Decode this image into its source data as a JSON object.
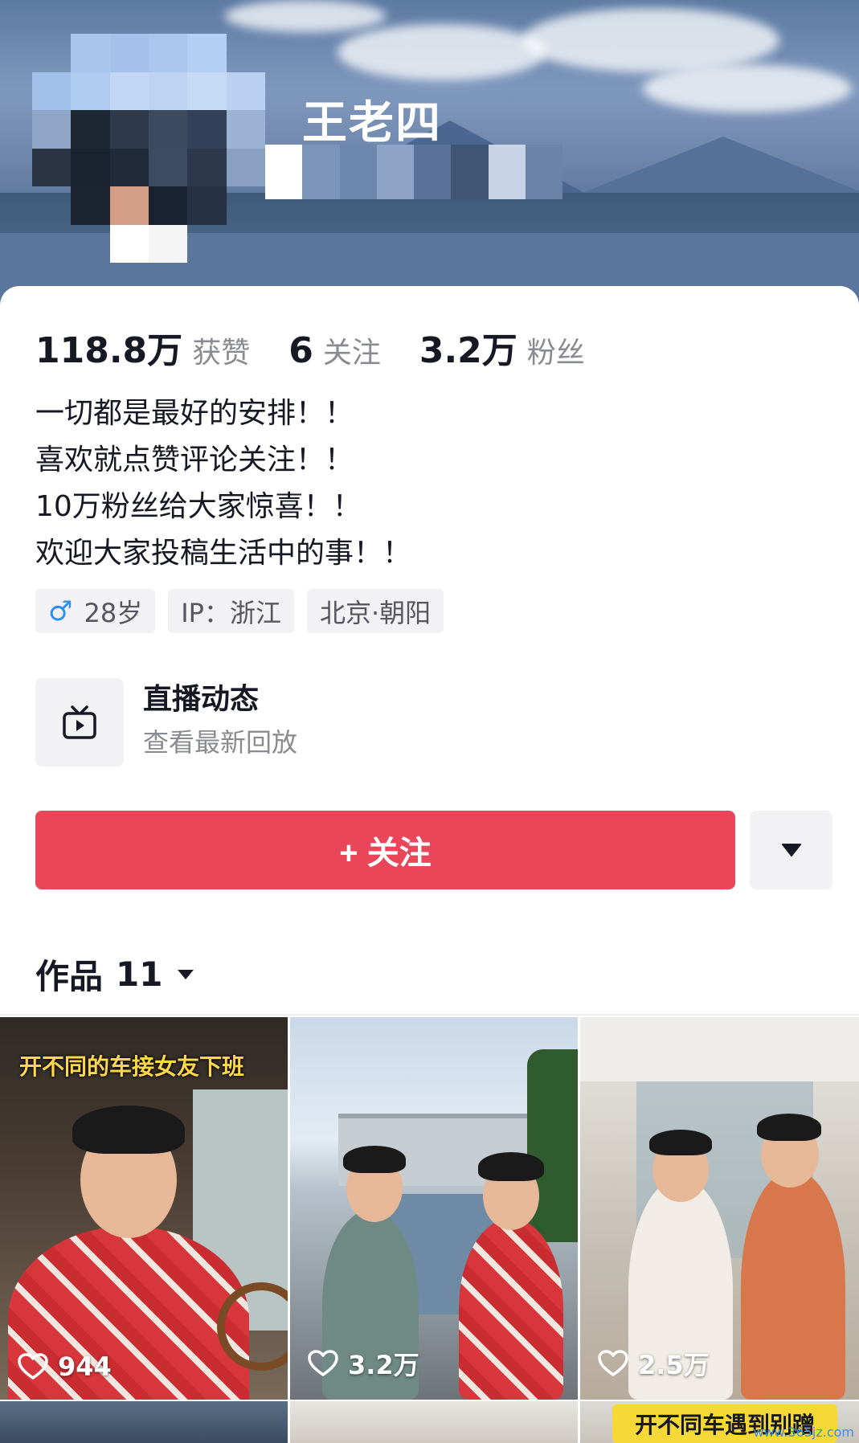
{
  "profile": {
    "username": "王老四",
    "stats": {
      "likes_value": "118.8万",
      "likes_label": "获赞",
      "following_value": "6",
      "following_label": "关注",
      "followers_value": "3.2万",
      "followers_label": "粉丝"
    },
    "bio": [
      "一切都是最好的安排！！",
      "喜欢就点赞评论关注！！",
      "10万粉丝给大家惊喜！！",
      "欢迎大家投稿生活中的事！！"
    ],
    "tags": {
      "gender_symbol": "♂",
      "age": "28岁",
      "ip": "IP：浙江",
      "location": "北京·朝阳"
    }
  },
  "live": {
    "icon": "tv-play-icon",
    "title": "直播动态",
    "subtitle": "查看最新回放"
  },
  "actions": {
    "follow_label": "+ 关注",
    "more_icon": "triangle-down-icon"
  },
  "works": {
    "title": "作品",
    "count": "11",
    "items": [
      {
        "caption": "开不同的车接女友下班",
        "likes": "944"
      },
      {
        "caption": "",
        "likes": "3.2万"
      },
      {
        "caption": "",
        "likes": "2.5万"
      },
      {
        "caption": "",
        "likes": ""
      },
      {
        "caption": "",
        "likes": ""
      },
      {
        "caption": "开不同车遇到别蹭",
        "likes": ""
      }
    ]
  },
  "watermark": "www.365jz.com",
  "colors": {
    "follow_button": "#ea4659",
    "male_icon": "#2f8ff0",
    "caption_yellow": "#ffd84a"
  }
}
